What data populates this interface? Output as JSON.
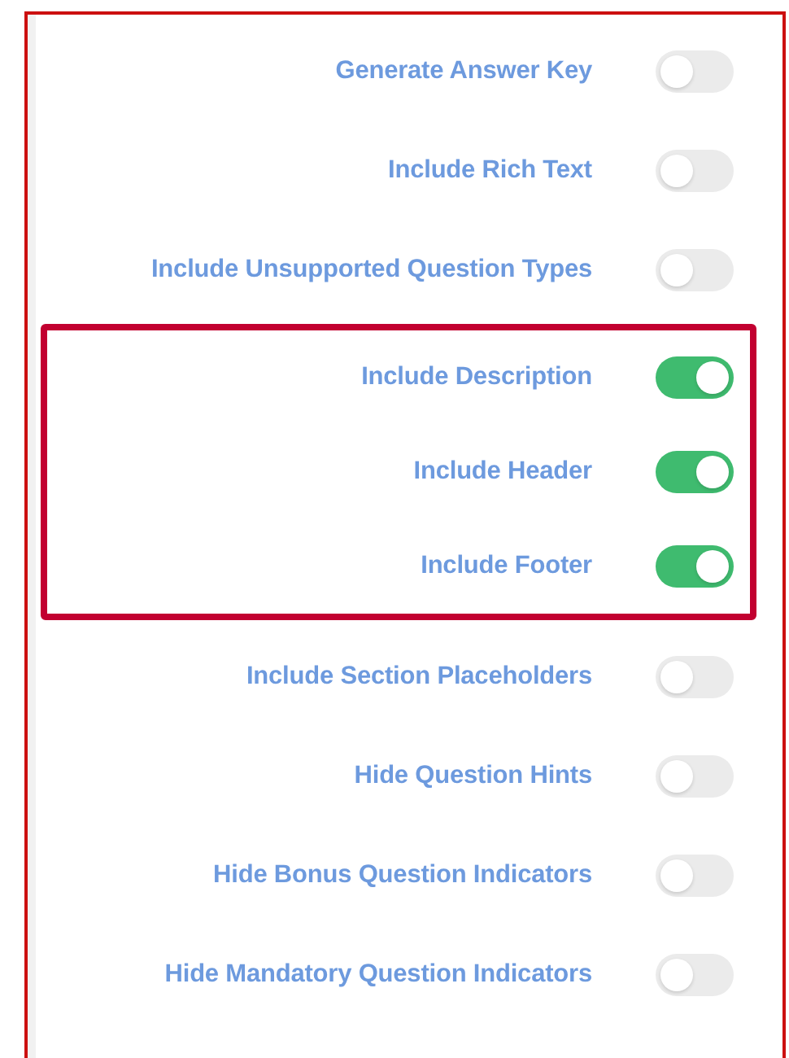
{
  "sections": [
    {
      "highlighted": false,
      "options": [
        {
          "label": "Generate Answer Key",
          "on": false
        },
        {
          "label": "Include Rich Text",
          "on": false
        },
        {
          "label": "Include Unsupported Question Types",
          "on": false
        }
      ]
    },
    {
      "highlighted": true,
      "options": [
        {
          "label": "Include Description",
          "on": true
        },
        {
          "label": "Include Header",
          "on": true
        },
        {
          "label": "Include Footer",
          "on": true
        }
      ]
    },
    {
      "highlighted": false,
      "options": [
        {
          "label": "Include Section Placeholders",
          "on": false
        },
        {
          "label": "Hide Question Hints",
          "on": false
        },
        {
          "label": "Hide Bonus Question Indicators",
          "on": false
        },
        {
          "label": "Hide Mandatory Question Indicators",
          "on": false
        }
      ]
    }
  ]
}
